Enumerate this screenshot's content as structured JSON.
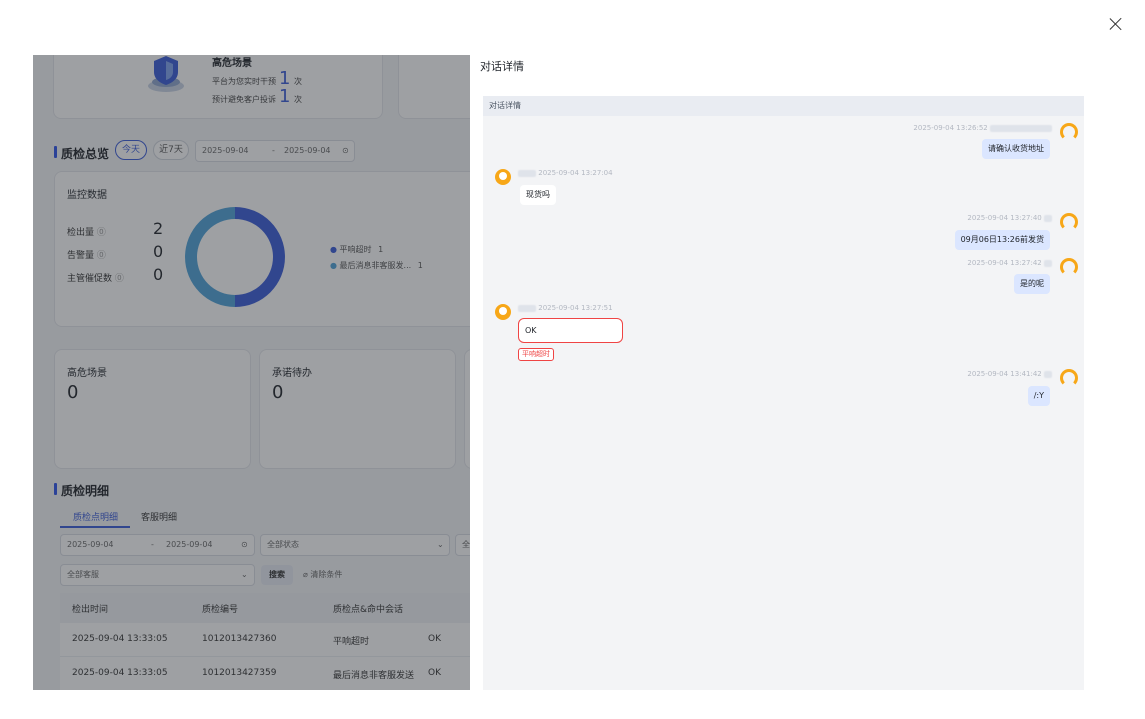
{
  "modal": {
    "title": "对话详情",
    "close_icon": "close-icon"
  },
  "chat": {
    "header": "对话详情",
    "messages": [
      {
        "side": "right",
        "time": "2025-09-04 13:26:52",
        "text": "请确认收货地址"
      },
      {
        "side": "left",
        "time": "2025-09-04 13:27:04",
        "text": "现货吗"
      },
      {
        "side": "right",
        "time": "2025-09-04 13:27:40",
        "text": "09月06日13:26前发货"
      },
      {
        "side": "right",
        "time": "2025-09-04 13:27:42",
        "text": "是的呢"
      },
      {
        "side": "left",
        "time": "2025-09-04 13:27:51",
        "text": "OK",
        "tag": "平响超时"
      },
      {
        "side": "right",
        "time": "2025-09-04 13:41:42",
        "text": "/:Y"
      }
    ]
  },
  "background": {
    "top_card": {
      "title": "高危场景",
      "line1_label": "平台为您实时干预",
      "line1_value": "1",
      "line1_unit": "次",
      "line2_label": "预计避免客户投诉",
      "line2_value": "1",
      "line2_unit": "次"
    },
    "overview": {
      "title": "质检总览",
      "pill_today": "今天",
      "pill_7days": "近7天",
      "date_start": "2025-09-04",
      "date_sep": "-",
      "date_end": "2025-09-04"
    },
    "monitor": {
      "title": "监控数据",
      "stats": [
        {
          "label": "检出量",
          "value": "2"
        },
        {
          "label": "告警量",
          "value": "0"
        },
        {
          "label": "主管催促数",
          "value": "0"
        }
      ],
      "legend": [
        {
          "label": "平响超时",
          "value": "1",
          "color": "#3a5bd9"
        },
        {
          "label": "最后消息非客服发...",
          "value": "1",
          "color": "#4fa3d9"
        }
      ]
    },
    "cards": [
      {
        "title": "高危场景",
        "value": "0"
      },
      {
        "title": "承诺待办",
        "value": "0"
      }
    ],
    "detail": {
      "title": "质检明细",
      "tab_points": "质检点明细",
      "tab_agents": "客服明细",
      "date_start": "2025-09-04",
      "date_sep": "-",
      "date_end": "2025-09-04",
      "status_placeholder": "全部状态",
      "third_select": "全",
      "agent_placeholder": "全部客服",
      "search_button": "搜索",
      "clear_button": "清除条件",
      "columns": [
        "检出时间",
        "质检编号",
        "质检点&命中会话"
      ],
      "rows": [
        {
          "time": "2025-09-04 13:33:05",
          "id": "1012013427360",
          "point": "平响超时",
          "session": "OK"
        },
        {
          "time": "2025-09-04 13:33:05",
          "id": "1012013427359",
          "point": "最后消息非客服发送",
          "session": "OK"
        }
      ]
    }
  },
  "colors": {
    "accent": "#3a5bd9",
    "donut_dark": "#3a5bd9",
    "donut_light": "#4fa3d9",
    "alert": "#ef4444",
    "avatar": "#f7a718",
    "bubble_right": "#dbe6ff"
  }
}
